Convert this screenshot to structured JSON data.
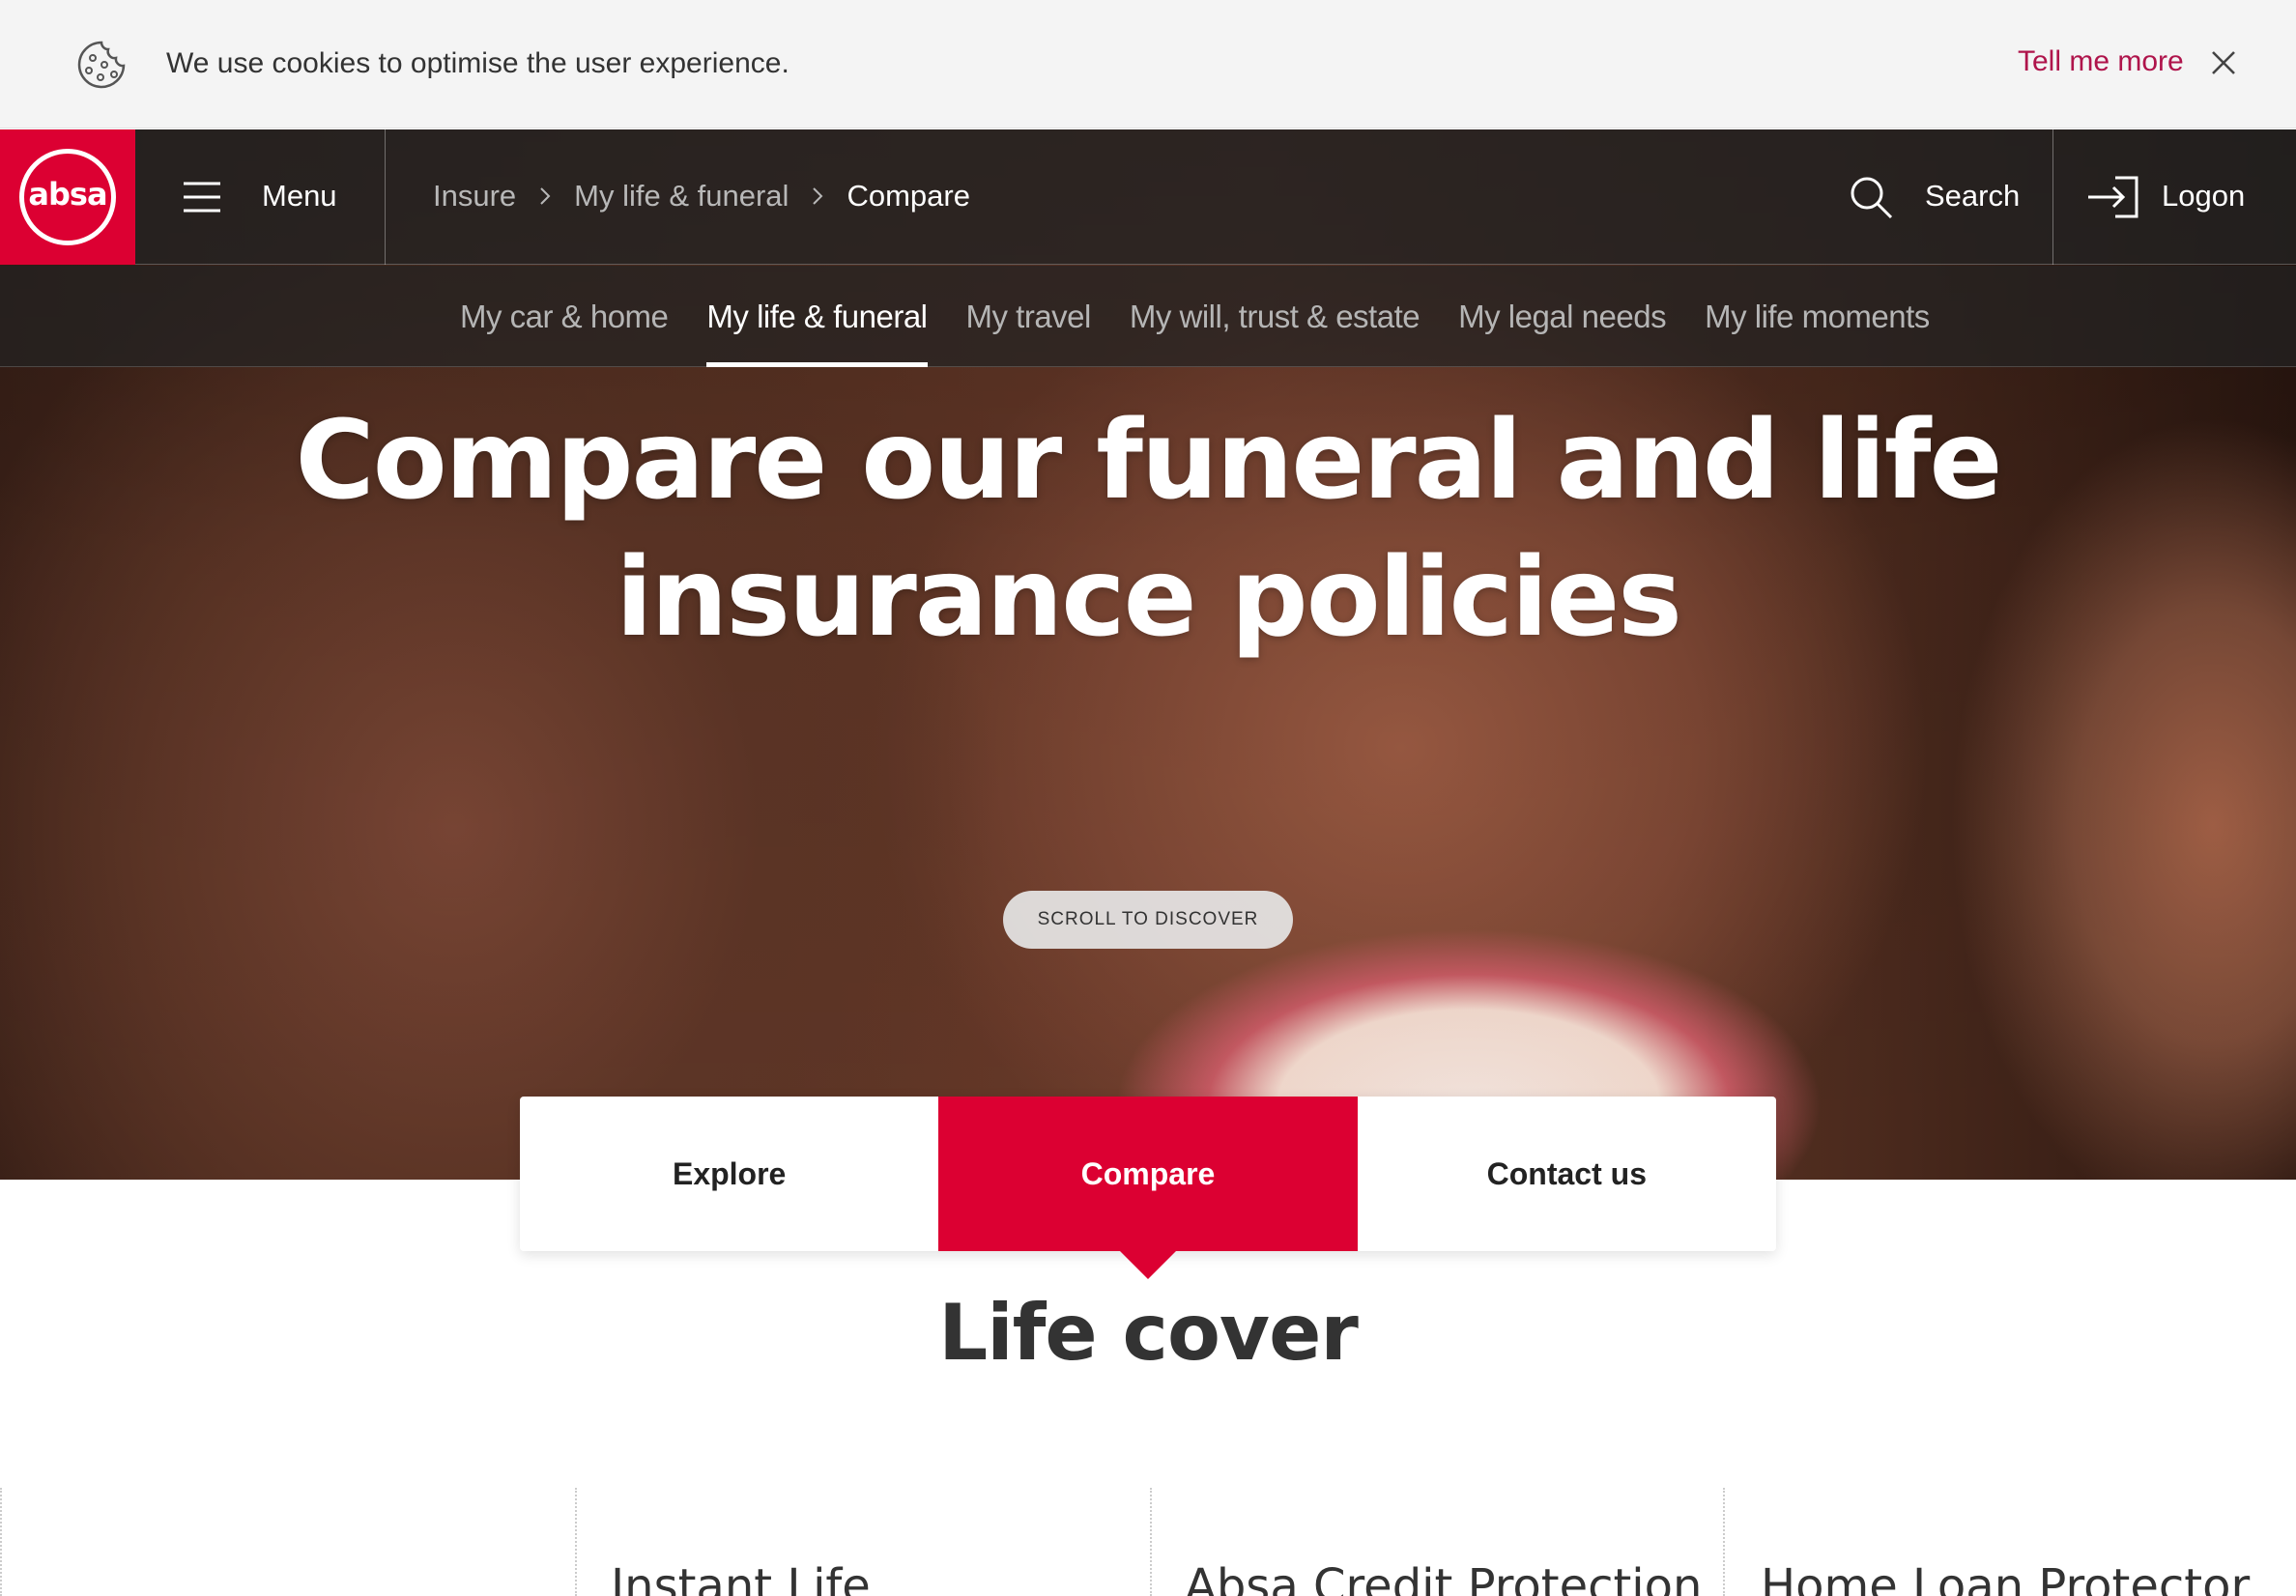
{
  "cookie_bar": {
    "icon": "cookie-icon",
    "message": "We use cookies to optimise the user experience.",
    "link_label": "Tell me more",
    "close_icon": "close-icon"
  },
  "header": {
    "logo_text": "absa",
    "menu_label": "Menu",
    "breadcrumb": [
      "Insure",
      "My life & funeral",
      "Compare"
    ],
    "search_label": "Search",
    "logon_label": "Logon"
  },
  "subnav": {
    "items": [
      "My car & home",
      "My life & funeral",
      "My travel",
      "My will, trust & estate",
      "My legal needs",
      "My life moments"
    ],
    "active_index": 1
  },
  "hero": {
    "title": "Compare our funeral and life insurance policies",
    "scroll_label": "SCROLL TO DISCOVER"
  },
  "tabs": {
    "items": [
      "Explore",
      "Compare",
      "Contact us"
    ],
    "active_index": 1
  },
  "section": {
    "title": "Life cover",
    "cards": [
      "Instant Life",
      "Absa Credit Protection",
      "Home Loan Protector"
    ]
  },
  "colors": {
    "brand_red": "#dc0032",
    "link_red": "#af144b"
  }
}
